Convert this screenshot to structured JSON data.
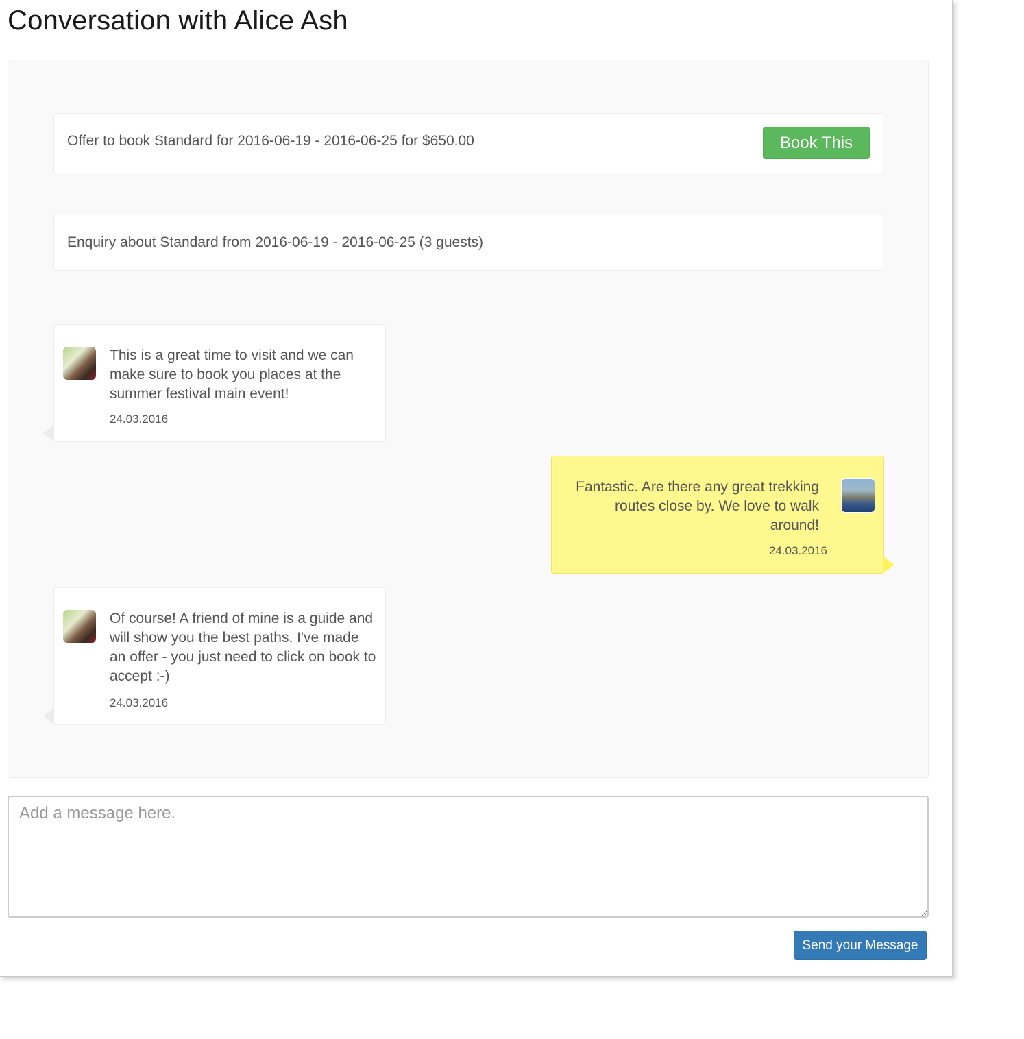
{
  "page": {
    "title": "Conversation with Alice Ash"
  },
  "offer": {
    "text": "Offer to book Standard for 2016-06-19 - 2016-06-25 for $650.00",
    "button_label": "Book This",
    "button_color": "#5cb85c"
  },
  "enquiry": {
    "text": "Enquiry about Standard from 2016-06-19 - 2016-06-25 (3 guests)"
  },
  "messages": [
    {
      "side": "left",
      "avatar": "alice-avatar",
      "text": "This is a great time to visit and we can make sure to book you places at the summer festival main event!",
      "date": "24.03.2016"
    },
    {
      "side": "right",
      "avatar": "guest-avatar",
      "text": "Fantastic. Are there any great trekking routes close by. We love to walk around!",
      "date": "24.03.2016",
      "bubble_color": "#fff88e"
    },
    {
      "side": "left",
      "avatar": "alice-avatar",
      "text": "Of course! A friend of mine is a guide and will show you the best paths. I've made an offer - you just need to click on book to accept :-)",
      "date": "24.03.2016"
    }
  ],
  "composer": {
    "placeholder": "Add a message here.",
    "value": "",
    "send_label": "Send your Message",
    "send_color": "#337ab7"
  }
}
